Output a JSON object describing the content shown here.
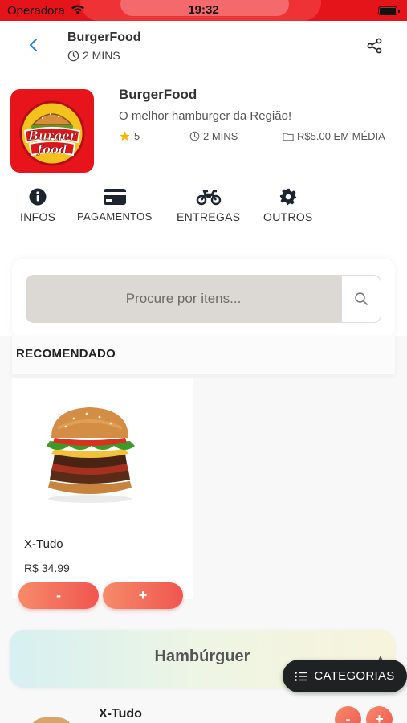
{
  "status_bar": {
    "carrier": "Operadora",
    "time": "19:32"
  },
  "header": {
    "title": "BurgerFood",
    "time": "2 MINS"
  },
  "store": {
    "name": "BurgerFood",
    "description": "O melhor hamburger da Região!",
    "rating": "5",
    "delivery_time": "2 MINS",
    "avg_price": "R$5.00 EM MÉDIA",
    "logo_text_line1": "Burger",
    "logo_text_line2": "food"
  },
  "nav": [
    {
      "label": "INFOS",
      "icon": "info-icon"
    },
    {
      "label": "PAGAMENTOS",
      "icon": "credit-card-icon"
    },
    {
      "label": "ENTREGAS",
      "icon": "motorcycle-icon"
    },
    {
      "label": "OUTROS",
      "icon": "gear-icon"
    }
  ],
  "search": {
    "placeholder": "Procure por itens..."
  },
  "section": {
    "title": "RECOMENDADO"
  },
  "recommended": [
    {
      "name": "X-Tudo",
      "price": "R$ 34.99",
      "minus": "-",
      "plus": "+"
    }
  ],
  "category": {
    "title": "Hambúrguer"
  },
  "fab": {
    "label": "CATEGORIAS"
  },
  "list": [
    {
      "name": "X-Tudo",
      "minus": "-",
      "plus": "+"
    }
  ],
  "colors": {
    "brand_red": "#e5141b",
    "accent_orange": "#f0564f",
    "dark_fab": "#1f2222"
  }
}
